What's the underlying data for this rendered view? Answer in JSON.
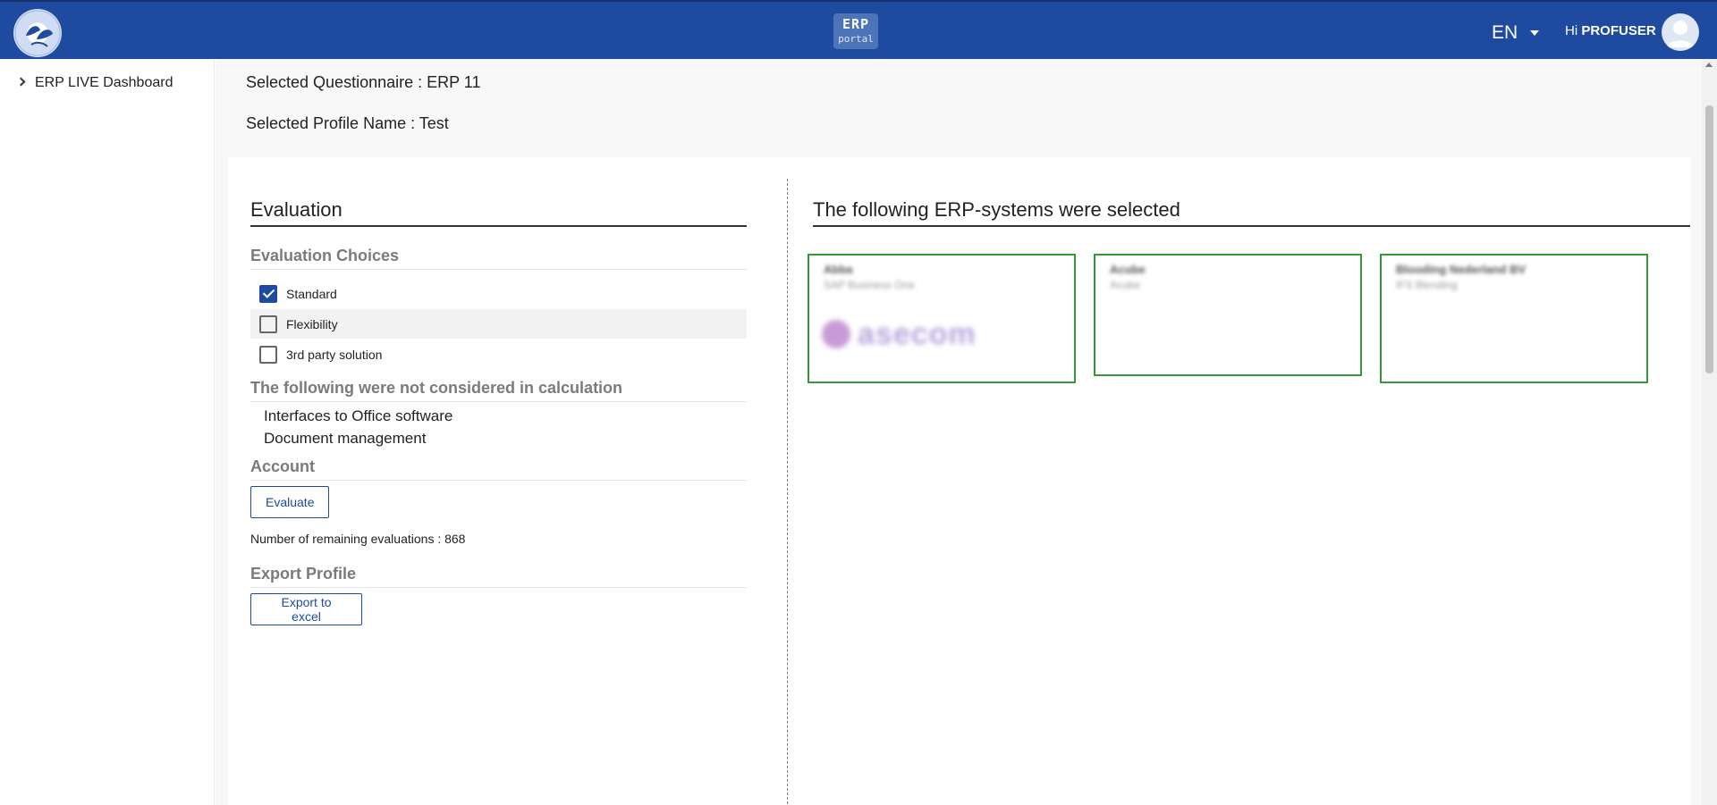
{
  "header": {
    "badge_top": "ERP",
    "badge_bottom": "portal",
    "language": "EN",
    "greeting": "Hi",
    "username": "PROFUSER"
  },
  "sidebar": {
    "items": [
      {
        "label": "ERP LIVE Dashboard"
      }
    ]
  },
  "selection": {
    "questionnaire": "Selected Questionnaire : ERP 11",
    "profile": "Selected Profile Name : Test"
  },
  "evaluation": {
    "title": "Evaluation",
    "choices_title": "Evaluation Choices",
    "choices": [
      {
        "label": "Standard",
        "checked": true
      },
      {
        "label": "Flexibility",
        "checked": false
      },
      {
        "label": "3rd party solution",
        "checked": false
      }
    ],
    "not_considered_title": "The following were not considered in calculation",
    "not_considered": [
      "Interfaces to Office software",
      "Document management"
    ],
    "account_title": "Account",
    "evaluate_label": "Evaluate",
    "remaining": "Number of remaining evaluations : 868",
    "export_title": "Export Profile",
    "export_label": "Export to excel"
  },
  "systems": {
    "title": "The following ERP-systems were selected",
    "cards": [
      {
        "vendor": "Abba",
        "product": "SAP Business One",
        "logo_text": "asecom"
      },
      {
        "vendor": "Acube",
        "product": "Acube",
        "logo_text": ""
      },
      {
        "vendor": "Blooding Nederland BV",
        "product": "IFS Blending",
        "logo_text": ""
      }
    ]
  },
  "colors": {
    "header_bg": "#1e4ba0",
    "card_border": "#2e9a38",
    "accent": "#1e4ba0"
  }
}
